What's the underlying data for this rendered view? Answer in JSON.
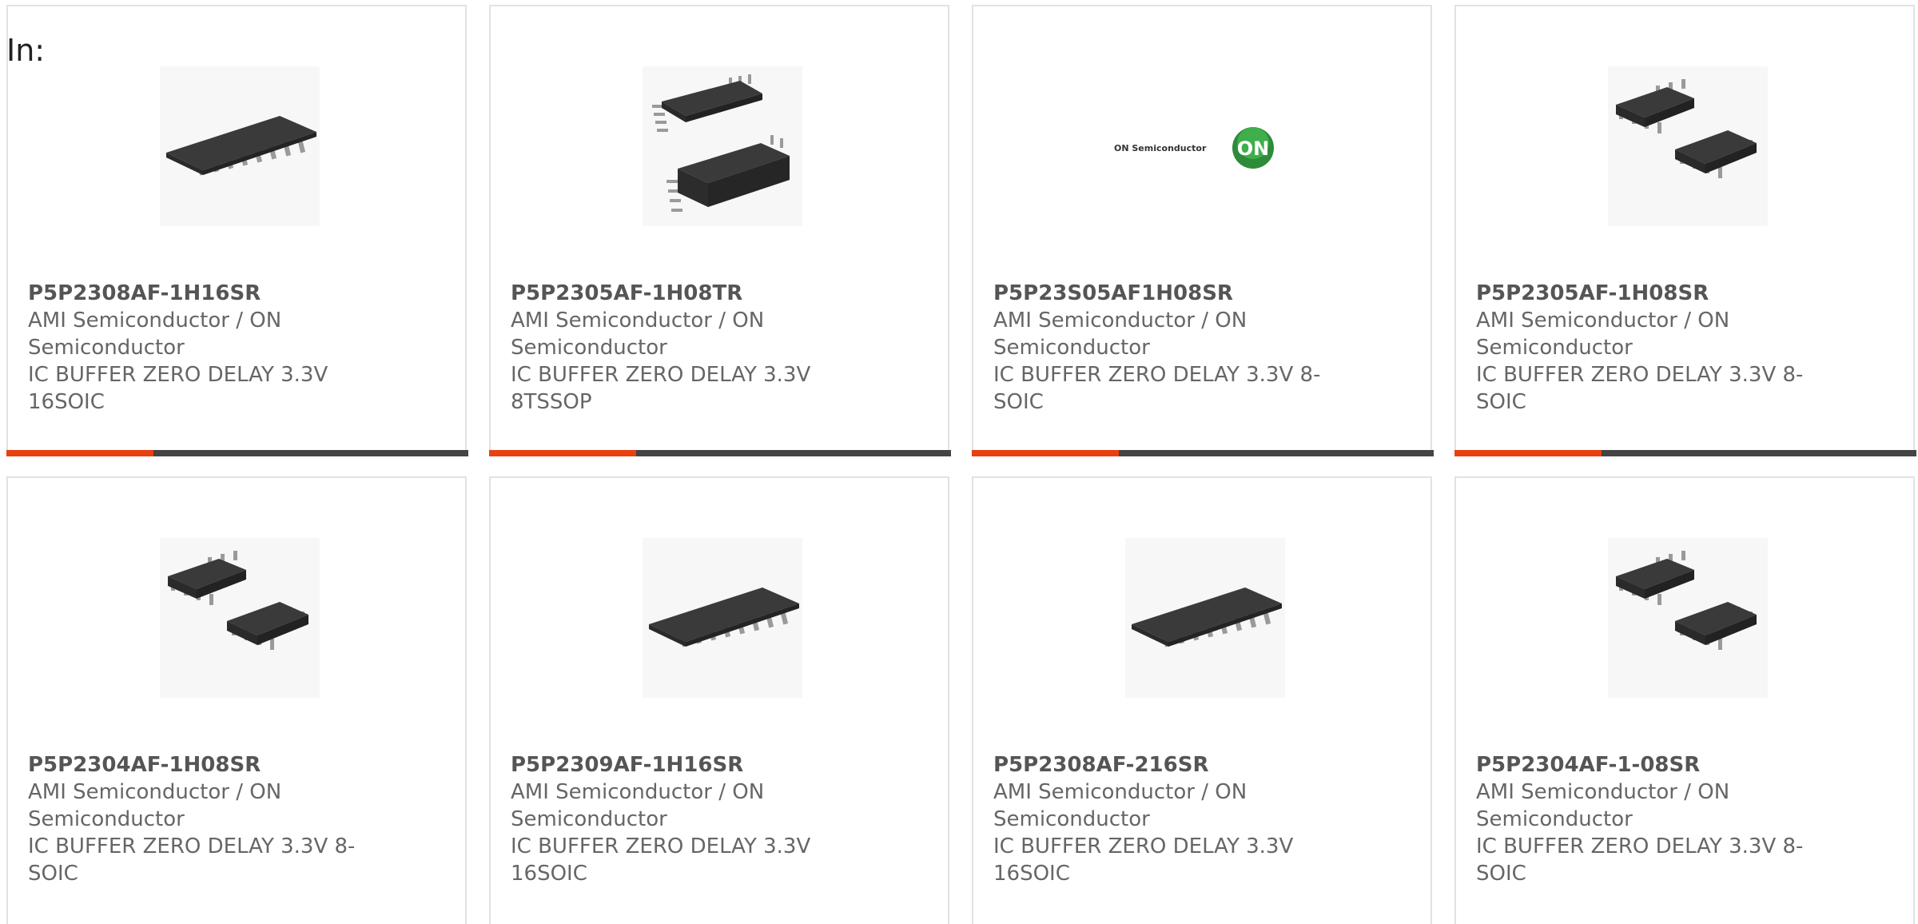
{
  "filter_label": "In:",
  "colors": {
    "accent": "#e8400f",
    "bar": "#444444",
    "card_border": "#e2e2e2",
    "part_text": "#555555",
    "body_text": "#666666"
  },
  "products": [
    {
      "part_number": "P5P2308AF-1H16SR",
      "manufacturer": "AMI Semiconductor / ON Semiconductor",
      "description": "IC BUFFER ZERO DELAY 3.3V 16SOIC",
      "image": "soic16-chip"
    },
    {
      "part_number": "P5P2305AF-1H08TR",
      "manufacturer": "AMI Semiconductor / ON Semiconductor",
      "description": "IC BUFFER ZERO DELAY 3.3V 8TSSOP",
      "image": "tssop8-chips"
    },
    {
      "part_number": "P5P23S05AF1H08SR",
      "manufacturer": "AMI Semiconductor / ON Semiconductor",
      "description": "IC BUFFER ZERO DELAY 3.3V 8-SOIC",
      "image": "on-semiconductor-logo",
      "logo_text": "ON Semiconductor",
      "logo_badge": "ON"
    },
    {
      "part_number": "P5P2305AF-1H08SR",
      "manufacturer": "AMI Semiconductor / ON Semiconductor",
      "description": "IC BUFFER ZERO DELAY 3.3V 8-SOIC",
      "image": "soic8-chips"
    },
    {
      "part_number": "P5P2304AF-1H08SR",
      "manufacturer": "AMI Semiconductor / ON Semiconductor",
      "description": "IC BUFFER ZERO DELAY 3.3V 8-SOIC",
      "image": "soic8-chips"
    },
    {
      "part_number": "P5P2309AF-1H16SR",
      "manufacturer": "AMI Semiconductor / ON Semiconductor",
      "description": "IC BUFFER ZERO DELAY 3.3V 16SOIC",
      "image": "soic16-chip"
    },
    {
      "part_number": "P5P2308AF-216SR",
      "manufacturer": "AMI Semiconductor / ON Semiconductor",
      "description": "IC BUFFER ZERO DELAY 3.3V 16SOIC",
      "image": "soic16-chip"
    },
    {
      "part_number": "P5P2304AF-1-08SR",
      "manufacturer": "AMI Semiconductor / ON Semiconductor",
      "description": "IC BUFFER ZERO DELAY 3.3V 8-SOIC",
      "image": "soic8-chips"
    }
  ]
}
